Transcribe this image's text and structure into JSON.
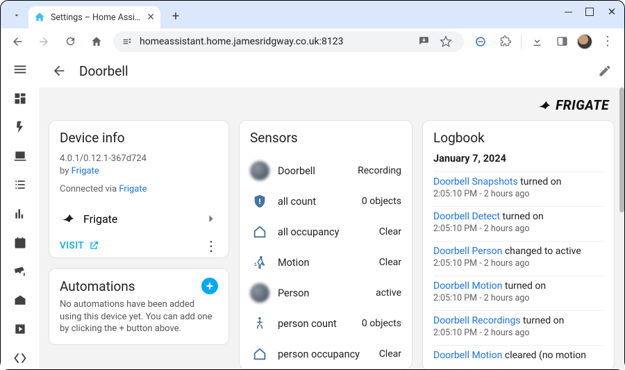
{
  "browser": {
    "tab_title": "Settings – Home Assista",
    "url": "homeassistant.home.jamesridgway.co.uk:8123"
  },
  "app": {
    "page_title": "Doorbell",
    "brand": "FRIGATE"
  },
  "device_info": {
    "heading": "Device info",
    "version": "4.0.1/0.12.1-367d724",
    "by_prefix": "by ",
    "by_link": "Frigate",
    "connected_prefix": "Connected via ",
    "connected_link": "Frigate",
    "integration_name": "Frigate",
    "visit_label": "VISIT"
  },
  "automations": {
    "heading": "Automations",
    "empty_text": "No automations have been added using this device yet. You can add one by clicking the + button above."
  },
  "sensors": {
    "heading": "Sensors",
    "rows": [
      {
        "name": "Doorbell",
        "state": "Recording"
      },
      {
        "name": "all count",
        "state": "0 objects"
      },
      {
        "name": "all occupancy",
        "state": "Clear"
      },
      {
        "name": "Motion",
        "state": "Clear"
      },
      {
        "name": "Person",
        "state": "active"
      },
      {
        "name": "person count",
        "state": "0 objects"
      },
      {
        "name": "person occupancy",
        "state": "Clear"
      }
    ]
  },
  "logbook": {
    "heading": "Logbook",
    "date": "January 7, 2024",
    "entries": [
      {
        "entity": "Doorbell Snapshots",
        "action": "turned on",
        "time": "2:05:10 PM",
        "rel": "2 hours ago"
      },
      {
        "entity": "Doorbell Detect",
        "action": "turned on",
        "time": "2:05:10 PM",
        "rel": "2 hours ago"
      },
      {
        "entity": "Doorbell Person",
        "action": "changed to active",
        "time": "2:05:10 PM",
        "rel": "2 hours ago"
      },
      {
        "entity": "Doorbell Motion",
        "action": "turned on",
        "time": "2:05:10 PM",
        "rel": "2 hours ago"
      },
      {
        "entity": "Doorbell Recordings",
        "action": "turned on",
        "time": "2:05:10 PM",
        "rel": "2 hours ago"
      },
      {
        "entity": "Doorbell Motion",
        "action": "cleared (no motion",
        "time": "",
        "rel": ""
      }
    ]
  }
}
